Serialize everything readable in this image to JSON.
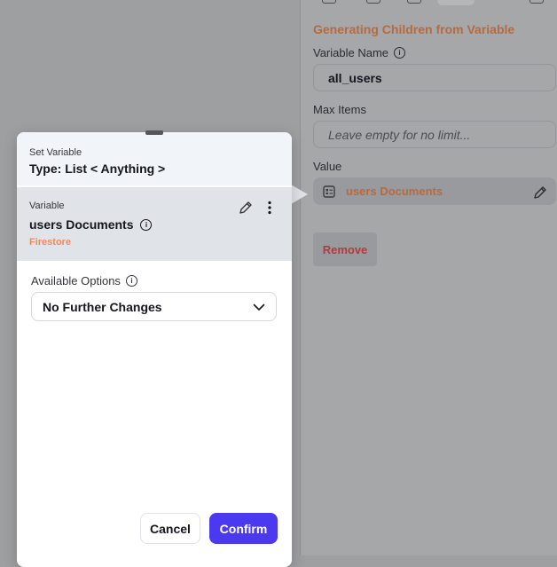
{
  "properties_panel": {
    "section_title": "Generating Children from Variable",
    "variable_name": {
      "label": "Variable Name",
      "value": "all_users"
    },
    "max_items": {
      "label": "Max Items",
      "placeholder": "Leave empty for no limit..."
    },
    "value_field": {
      "label": "Value",
      "value": "users Documents"
    },
    "remove_label": "Remove",
    "accent_color": "#b86a3c"
  },
  "dialog": {
    "kicker": "Set Variable",
    "title": "Type: List < Anything >",
    "variable": {
      "kicker": "Variable",
      "name": "users Documents",
      "source": "Firestore"
    },
    "options": {
      "label": "Available Options",
      "selected": "No Further Changes"
    },
    "cancel_label": "Cancel",
    "confirm_label": "Confirm",
    "confirm_color": "#4b39ef"
  },
  "icons": {
    "info": "info-icon",
    "edit": "pencil-icon",
    "more": "more-vertical-icon",
    "chevron": "chevron-down-icon",
    "document": "document-list-icon",
    "info_glyph": "i"
  }
}
